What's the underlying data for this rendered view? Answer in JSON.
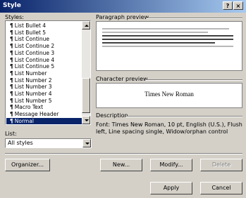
{
  "window": {
    "title": "Style",
    "help_label": "?",
    "close_label": "×"
  },
  "styles_section": {
    "label": "Styles:",
    "items": [
      "List Bullet 4",
      "List Bullet 5",
      "List Continue",
      "List Continue 2",
      "List Continue 3",
      "List Continue 4",
      "List Continue 5",
      "List Number",
      "List Number 2",
      "List Number 3",
      "List Number 4",
      "List Number 5",
      "Macro Text",
      "Message Header",
      "Normal"
    ],
    "selected": "Normal",
    "paragraph_mark": "¶"
  },
  "list_section": {
    "label": "List:",
    "value": "All styles"
  },
  "paragraph_preview": {
    "label": "Paragraph preview"
  },
  "character_preview": {
    "label": "Character preview",
    "sample": "Times New Roman"
  },
  "description": {
    "label": "Description",
    "text": "Font: Times New Roman, 10 pt, English (U.S.), Flush left, Line spacing single, Widow/orphan control"
  },
  "buttons": {
    "organizer": "Organizer...",
    "new": "New...",
    "modify": "Modify...",
    "delete": "Delete",
    "apply": "Apply",
    "cancel": "Cancel"
  }
}
